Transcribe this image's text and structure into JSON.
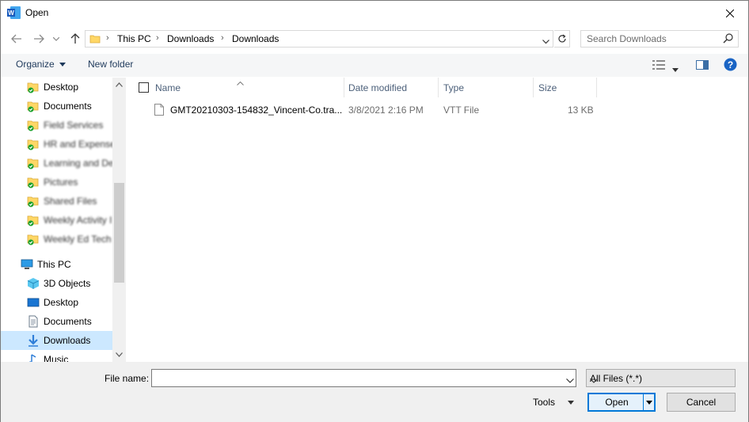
{
  "window": {
    "title": "Open"
  },
  "address": {
    "crumbs": [
      "This PC",
      "Downloads",
      "Downloads"
    ]
  },
  "search": {
    "placeholder": "Search Downloads"
  },
  "toolbar": {
    "organize": "Organize",
    "new_folder": "New folder"
  },
  "nav": {
    "items": [
      {
        "label": "Desktop",
        "icon": "folder-synced-icon",
        "blurred": false
      },
      {
        "label": "Documents",
        "icon": "folder-synced-icon",
        "blurred": false
      },
      {
        "label": "Field Services",
        "icon": "folder-synced-icon",
        "blurred": true
      },
      {
        "label": "HR and Expense",
        "icon": "folder-synced-icon",
        "blurred": true
      },
      {
        "label": "Learning and De",
        "icon": "folder-synced-icon",
        "blurred": true
      },
      {
        "label": "Pictures",
        "icon": "folder-synced-icon",
        "blurred": true
      },
      {
        "label": "Shared Files",
        "icon": "folder-synced-icon",
        "blurred": true
      },
      {
        "label": "Weekly Activity I",
        "icon": "folder-synced-icon",
        "blurred": true
      },
      {
        "label": "Weekly Ed Tech",
        "icon": "folder-synced-icon",
        "blurred": true
      },
      {
        "label": "This PC",
        "icon": "computer-icon",
        "blurred": false
      },
      {
        "label": "3D Objects",
        "icon": "cube-icon",
        "blurred": false
      },
      {
        "label": "Desktop",
        "icon": "desktop-icon",
        "blurred": false
      },
      {
        "label": "Documents",
        "icon": "document-icon",
        "blurred": false
      },
      {
        "label": "Downloads",
        "icon": "download-icon",
        "blurred": false,
        "selected": true
      },
      {
        "label": "Music",
        "icon": "music-icon",
        "blurred": false
      }
    ]
  },
  "columns": {
    "name": "Name",
    "date": "Date modified",
    "type": "Type",
    "size": "Size"
  },
  "files": [
    {
      "name": "GMT20210303-154832_Vincent-Co.tra...",
      "date": "3/8/2021 2:16 PM",
      "type": "VTT File",
      "size": "13 KB"
    }
  ],
  "bottom": {
    "file_name_label": "File name:",
    "file_name_value": "",
    "filter": "All Files (*.*)",
    "tools": "Tools",
    "open": "Open",
    "cancel": "Cancel"
  },
  "colors": {
    "accent": "#0078d7",
    "selected": "#cce8ff",
    "folder": "#ffd766",
    "sync": "#1aa12c"
  }
}
